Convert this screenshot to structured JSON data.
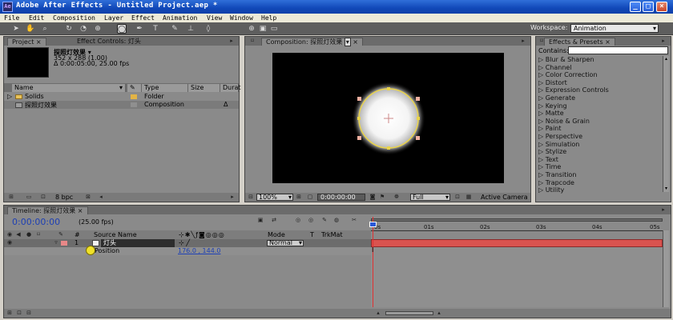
{
  "window": {
    "title": "Adobe After Effects - Untitled Project.aep *"
  },
  "menu": [
    "File",
    "Edit",
    "Composition",
    "Layer",
    "Effect",
    "Animation",
    "View",
    "Window",
    "Help"
  ],
  "workspace": {
    "label": "Workspace:",
    "value": "Animation"
  },
  "project_panel": {
    "tabs": [
      "Project",
      "Effect Controls: 灯头"
    ],
    "selected_item": {
      "name": "探照灯效果",
      "size_info": "352 x 288 (1.00)",
      "duration_info": "Δ 0:00:05:00, 25.00 fps"
    },
    "columns": [
      "Name",
      "Type",
      "Size",
      "Durat"
    ],
    "items": [
      {
        "name": "Solids",
        "type": "Folder"
      },
      {
        "name": "探照灯效果",
        "type": "Composition",
        "marker": "Δ"
      }
    ],
    "footer": {
      "bpc": "8 bpc"
    }
  },
  "composition_panel": {
    "tab": "Composition: 探照灯效果",
    "zoom": "100%",
    "timecode": "0:00:00:00",
    "resolution": "Full",
    "camera": "Active Camera"
  },
  "effects_panel": {
    "tab": "Effects & Presets",
    "contains_label": "Contains:",
    "categories": [
      "Blur & Sharpen",
      "Channel",
      "Color Correction",
      "Distort",
      "Expression Controls",
      "Generate",
      "Keying",
      "Matte",
      "Noise & Grain",
      "Paint",
      "Perspective",
      "Simulation",
      "Stylize",
      "Text",
      "Time",
      "Transition",
      "Trapcode",
      "Utility"
    ]
  },
  "timeline_panel": {
    "tab": "Timeline: 探照灯效果",
    "timecode": "0:00:00:00",
    "fps": "(25.00 fps)",
    "columns": {
      "num": "#",
      "source": "Source Name",
      "mode": "Mode",
      "t": "T",
      "trkmat": "TrkMat"
    },
    "layer": {
      "num": "1",
      "name": "灯头",
      "mode": "Normal"
    },
    "property": {
      "name": "Position",
      "value": "176.0 , 144.0"
    },
    "ruler": [
      "0s",
      "01s",
      "02s",
      "03s",
      "04s",
      "05s"
    ]
  }
}
